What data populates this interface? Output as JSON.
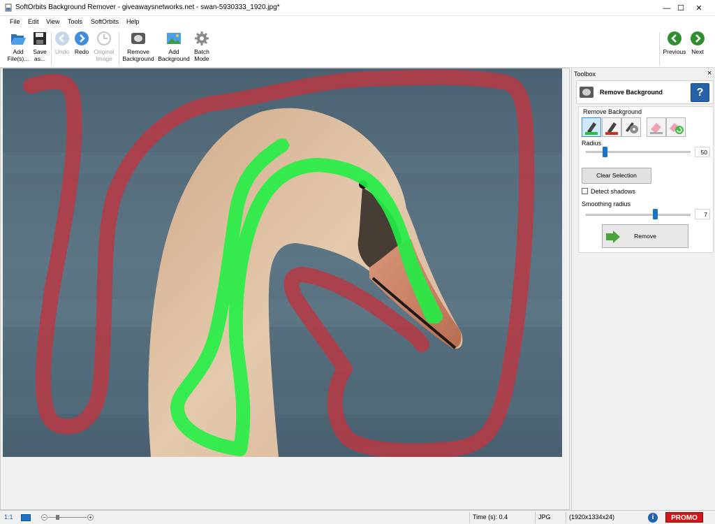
{
  "window": {
    "title": "SoftOrbits Background Remover - giveawaysnetworks.net - swan-5930333_1920.jpg*",
    "minimize_glyph": "—",
    "maximize_glyph": "☐",
    "close_glyph": "✕"
  },
  "menu": [
    "File",
    "Edit",
    "View",
    "Tools",
    "SoftOrbits",
    "Help"
  ],
  "toolbar": {
    "add_files": [
      "Add",
      "File(s)..."
    ],
    "save_as": [
      "Save",
      "as..."
    ],
    "undo": "Undo",
    "redo": "Redo",
    "original_image": [
      "Original",
      "Image"
    ],
    "remove_background": [
      "Remove",
      "Background"
    ],
    "add_background": [
      "Add",
      "Background"
    ],
    "batch_mode": [
      "Batch",
      "Mode"
    ],
    "previous": "Previous",
    "next": "Next"
  },
  "toolbox": {
    "header": "Toolbox",
    "close_glyph": "×",
    "panel_title": "Remove Background",
    "help_glyph": "?",
    "group_label": "Remove Background",
    "radius_label": "Radius",
    "radius_value": "50",
    "radius_fraction": 0.18,
    "clear_selection": "Clear Selection",
    "detect_shadows": "Detect shadows",
    "detect_shadows_checked": false,
    "smoothing_label": "Smoothing radius",
    "smoothing_value": "7",
    "smoothing_fraction": 0.66,
    "remove_button": "Remove"
  },
  "status": {
    "zoom_ratio": "1:1",
    "time": "Time (s): 0.4",
    "format": "JPG",
    "dimensions": "(1920x1334x24)",
    "promo": "PROMO"
  },
  "colors": {
    "accent": "#1a73c6",
    "keep_stroke": "#22ee44",
    "remove_stroke": "#b83a44",
    "promo": "#d01818"
  }
}
